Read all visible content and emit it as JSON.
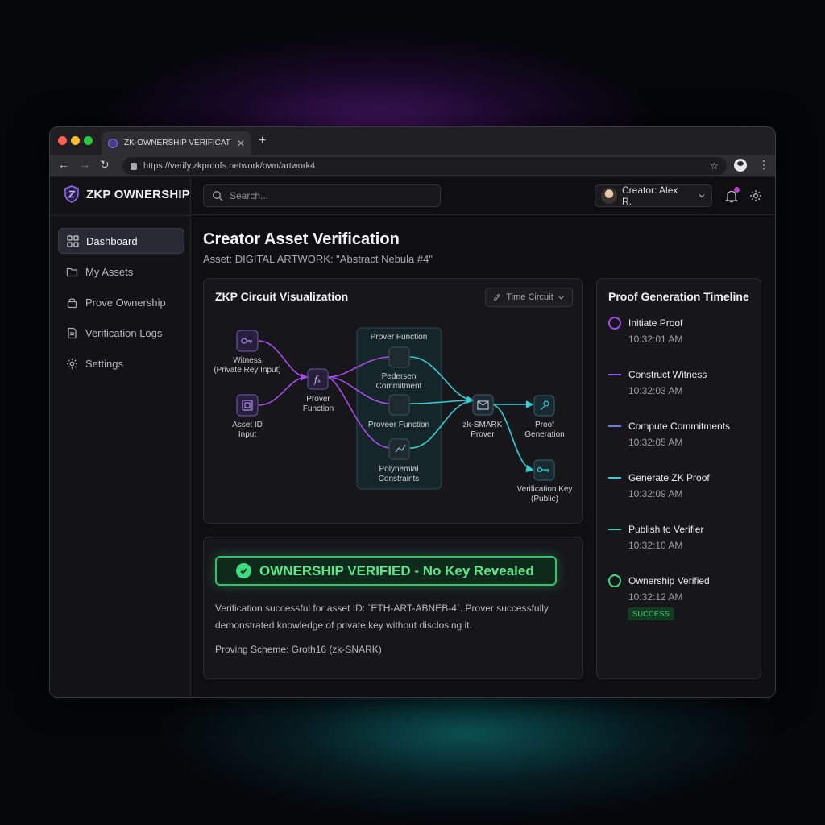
{
  "browser": {
    "tab_title": "ZK-OWNERSHIP VERIFICATION",
    "url": "https://verify.zkproofs.network/own/artwork4"
  },
  "sidebar": {
    "brand": "ZKP OWNERSHIP",
    "items": [
      {
        "label": "Dashboard",
        "icon": "grid-icon",
        "active": true
      },
      {
        "label": "My Assets",
        "icon": "folder-icon",
        "active": false
      },
      {
        "label": "Prove Ownership",
        "icon": "lock-icon",
        "active": false
      },
      {
        "label": "Verification Logs",
        "icon": "document-icon",
        "active": false
      },
      {
        "label": "Settings",
        "icon": "gear-icon",
        "active": false
      }
    ]
  },
  "topbar": {
    "search_placeholder": "Search...",
    "user_label": "Creator: Alex R."
  },
  "main": {
    "title": "Creator Asset Verification",
    "asset": "Asset: DIGITAL ARTWORK: \"Abstract Nebula #4\""
  },
  "circuit": {
    "title": "ZKP Circuit Visualization",
    "button": "Time Circuit",
    "group_title": "Prover Function",
    "nodes": {
      "witness": [
        "Witness",
        "(Private Rey Input)"
      ],
      "asset_id": [
        "Asset ID",
        "Input"
      ],
      "prover_fn": [
        "Prover",
        "Function"
      ],
      "pedersen": [
        "Pedersen",
        "Commitment"
      ],
      "proveer": [
        "Proveer Function"
      ],
      "polynomial": [
        "Polynemial",
        "Constraints"
      ],
      "snark": [
        "zk-SMARK",
        "Prover"
      ],
      "proof_gen": [
        "Proof",
        "Generation"
      ],
      "vkey": [
        "Verification Key",
        "(Public)"
      ]
    }
  },
  "verification": {
    "banner": "OWNERSHIP VERIFIED - No Key Revealed",
    "description": "Verification successful for asset ID: `ETH-ART-ABNEB-4`. Prover successfully demonstrated knowledge of private key without disclosing it.",
    "scheme": "Proving Scheme: Groth16 (zk-SNARK)"
  },
  "timeline": {
    "title": "Proof Generation Timeline",
    "events": [
      {
        "label": "Initiate Proof",
        "time": "10:32:01 AM"
      },
      {
        "label": "Construct Witness",
        "time": "10:32:03 AM"
      },
      {
        "label": "Compute Commitments",
        "time": "10:32:05 AM"
      },
      {
        "label": "Generate ZK Proof",
        "time": "10:32:09 AM"
      },
      {
        "label": "Publish to Verifier",
        "time": "10:32:10 AM"
      },
      {
        "label": "Ownership Verified",
        "time": "10:32:12 AM"
      }
    ],
    "status": "SUCCESS"
  },
  "colors": {
    "purple": "#a64de8",
    "teal": "#2fd0d6",
    "green": "#3ddc7e"
  }
}
